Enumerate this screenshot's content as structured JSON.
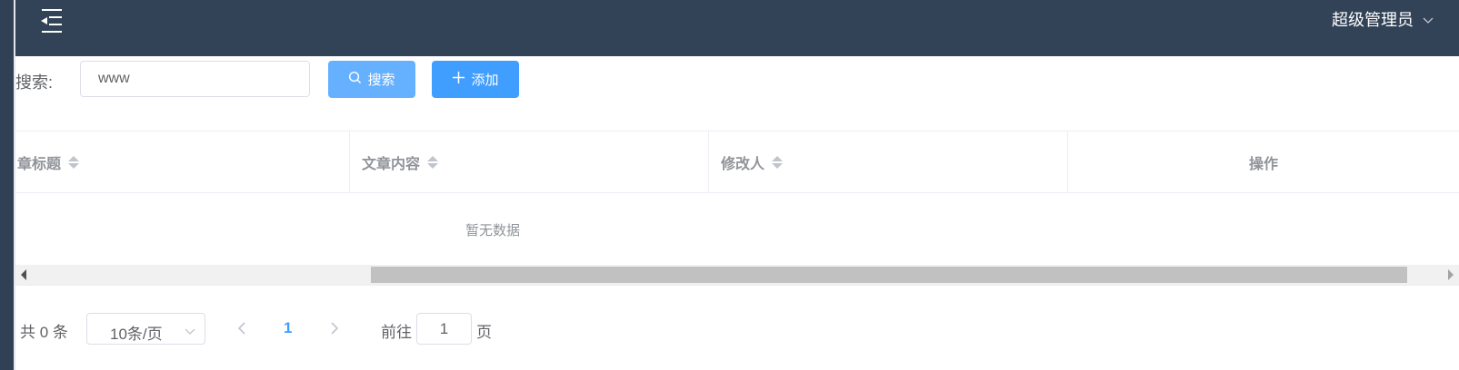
{
  "navbar": {
    "user_name": "超级管理员",
    "background": "#324257"
  },
  "search": {
    "label": "搜索:",
    "input_value": "www",
    "search_button": "搜索",
    "add_button": "添加"
  },
  "table": {
    "columns": [
      {
        "label": "章标题",
        "sortable": true
      },
      {
        "label": "文章内容",
        "sortable": true
      },
      {
        "label": "修改人",
        "sortable": true
      },
      {
        "label": "操作",
        "sortable": false
      }
    ],
    "empty_text": "暂无数据"
  },
  "pagination": {
    "total_text": "共 0 条",
    "page_size": "10条/页",
    "current_page": "1",
    "goto_prefix": "前往",
    "goto_value": "1",
    "goto_suffix": "页"
  },
  "colors": {
    "primary": "#409eff",
    "primary_light": "#66b1ff",
    "header_text": "#909399"
  }
}
